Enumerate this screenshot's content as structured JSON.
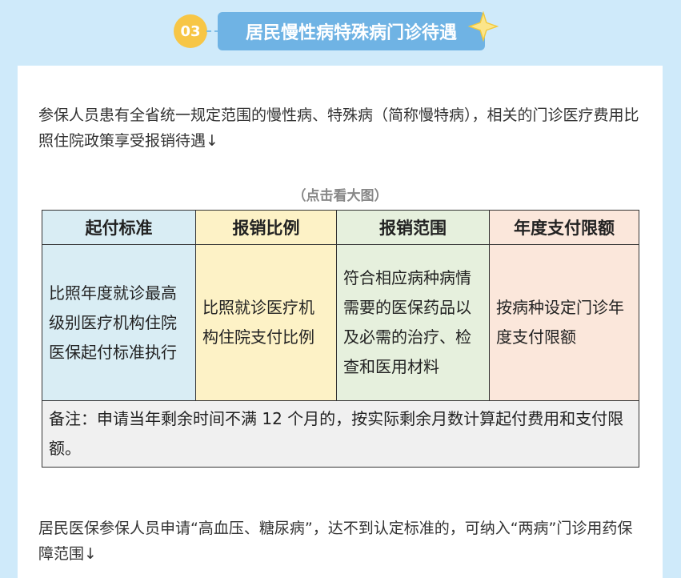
{
  "section": {
    "number": "03",
    "title": "居民慢性病特殊病门诊待遇"
  },
  "content": {
    "intro": "参保人员患有全省统一规定范围的慢性病、特殊病（简称慢特病），相关的门诊医疗费用比照住院政策享受报销待遇↓",
    "caption": "（点击看大图）",
    "table": {
      "headers": [
        "起付标准",
        "报销比例",
        "报销范围",
        "年度支付限额"
      ],
      "row": [
        "比照年度就诊最高级别医疗机构住院医保起付标准执行",
        "比照就诊医疗机构住院支付比例",
        "符合相应病种病情需要的医保药品以及必需的治疗、检查和医用材料",
        "按病种设定门诊年度支付限额"
      ],
      "note": "备注：申请当年剩余时间不满 12 个月的，按实际剩余月数计算起付费用和支付限额。"
    },
    "outro": "居民医保参保人员申请“高血压、糖尿病”，达不到认定标准的，可纳入“两病”门诊用药保障范围↓"
  },
  "colors": {
    "page_bg": "#cfeafa",
    "title_bg": "#6fb3e4",
    "badge_bg": "#f7c646",
    "col1_bg": "#d9edf4",
    "col2_bg": "#fdf2c6",
    "col3_bg": "#e6f0dd",
    "col4_bg": "#fbe7db"
  },
  "icons": {
    "decoration": "star-icon"
  }
}
